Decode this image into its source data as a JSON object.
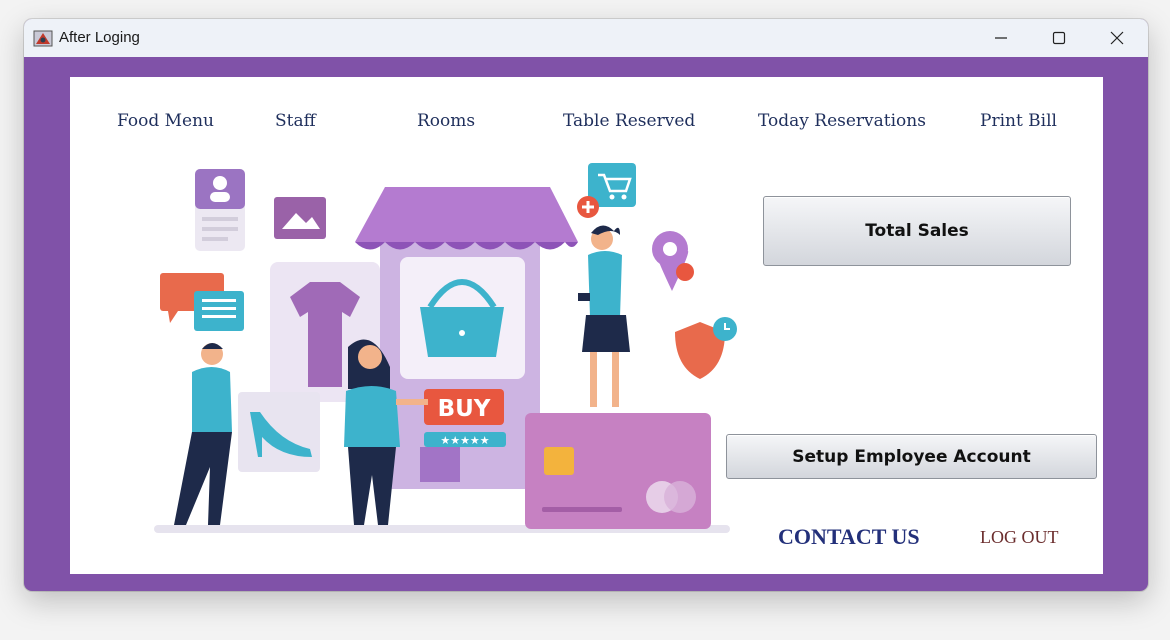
{
  "window": {
    "title": "After Loging"
  },
  "nav": {
    "items": [
      {
        "label": "Food Menu"
      },
      {
        "label": "Staff"
      },
      {
        "label": "Rooms"
      },
      {
        "label": "Table Reserved"
      },
      {
        "label": "Today Reservations"
      },
      {
        "label": "Print Bill"
      }
    ]
  },
  "buttons": {
    "total_sales": "Total Sales",
    "setup_employee": "Setup Employee Account"
  },
  "links": {
    "contact": "CONTACT US",
    "logout": "LOG OUT"
  },
  "illustration": {
    "buy_label": "BUY",
    "icons": [
      "shopping-cart-icon",
      "location-pin-icon",
      "shield-clock-icon",
      "profile-card-icon",
      "image-icon",
      "chat-bubbles-icon",
      "credit-card-icon",
      "handbag-icon",
      "shoe-icon",
      "shirt-icon"
    ]
  },
  "colors": {
    "frame": "#8052a8",
    "nav_text": "#1f2f5c",
    "contact_text": "#23307a",
    "logout_text": "#6b2d2d"
  }
}
